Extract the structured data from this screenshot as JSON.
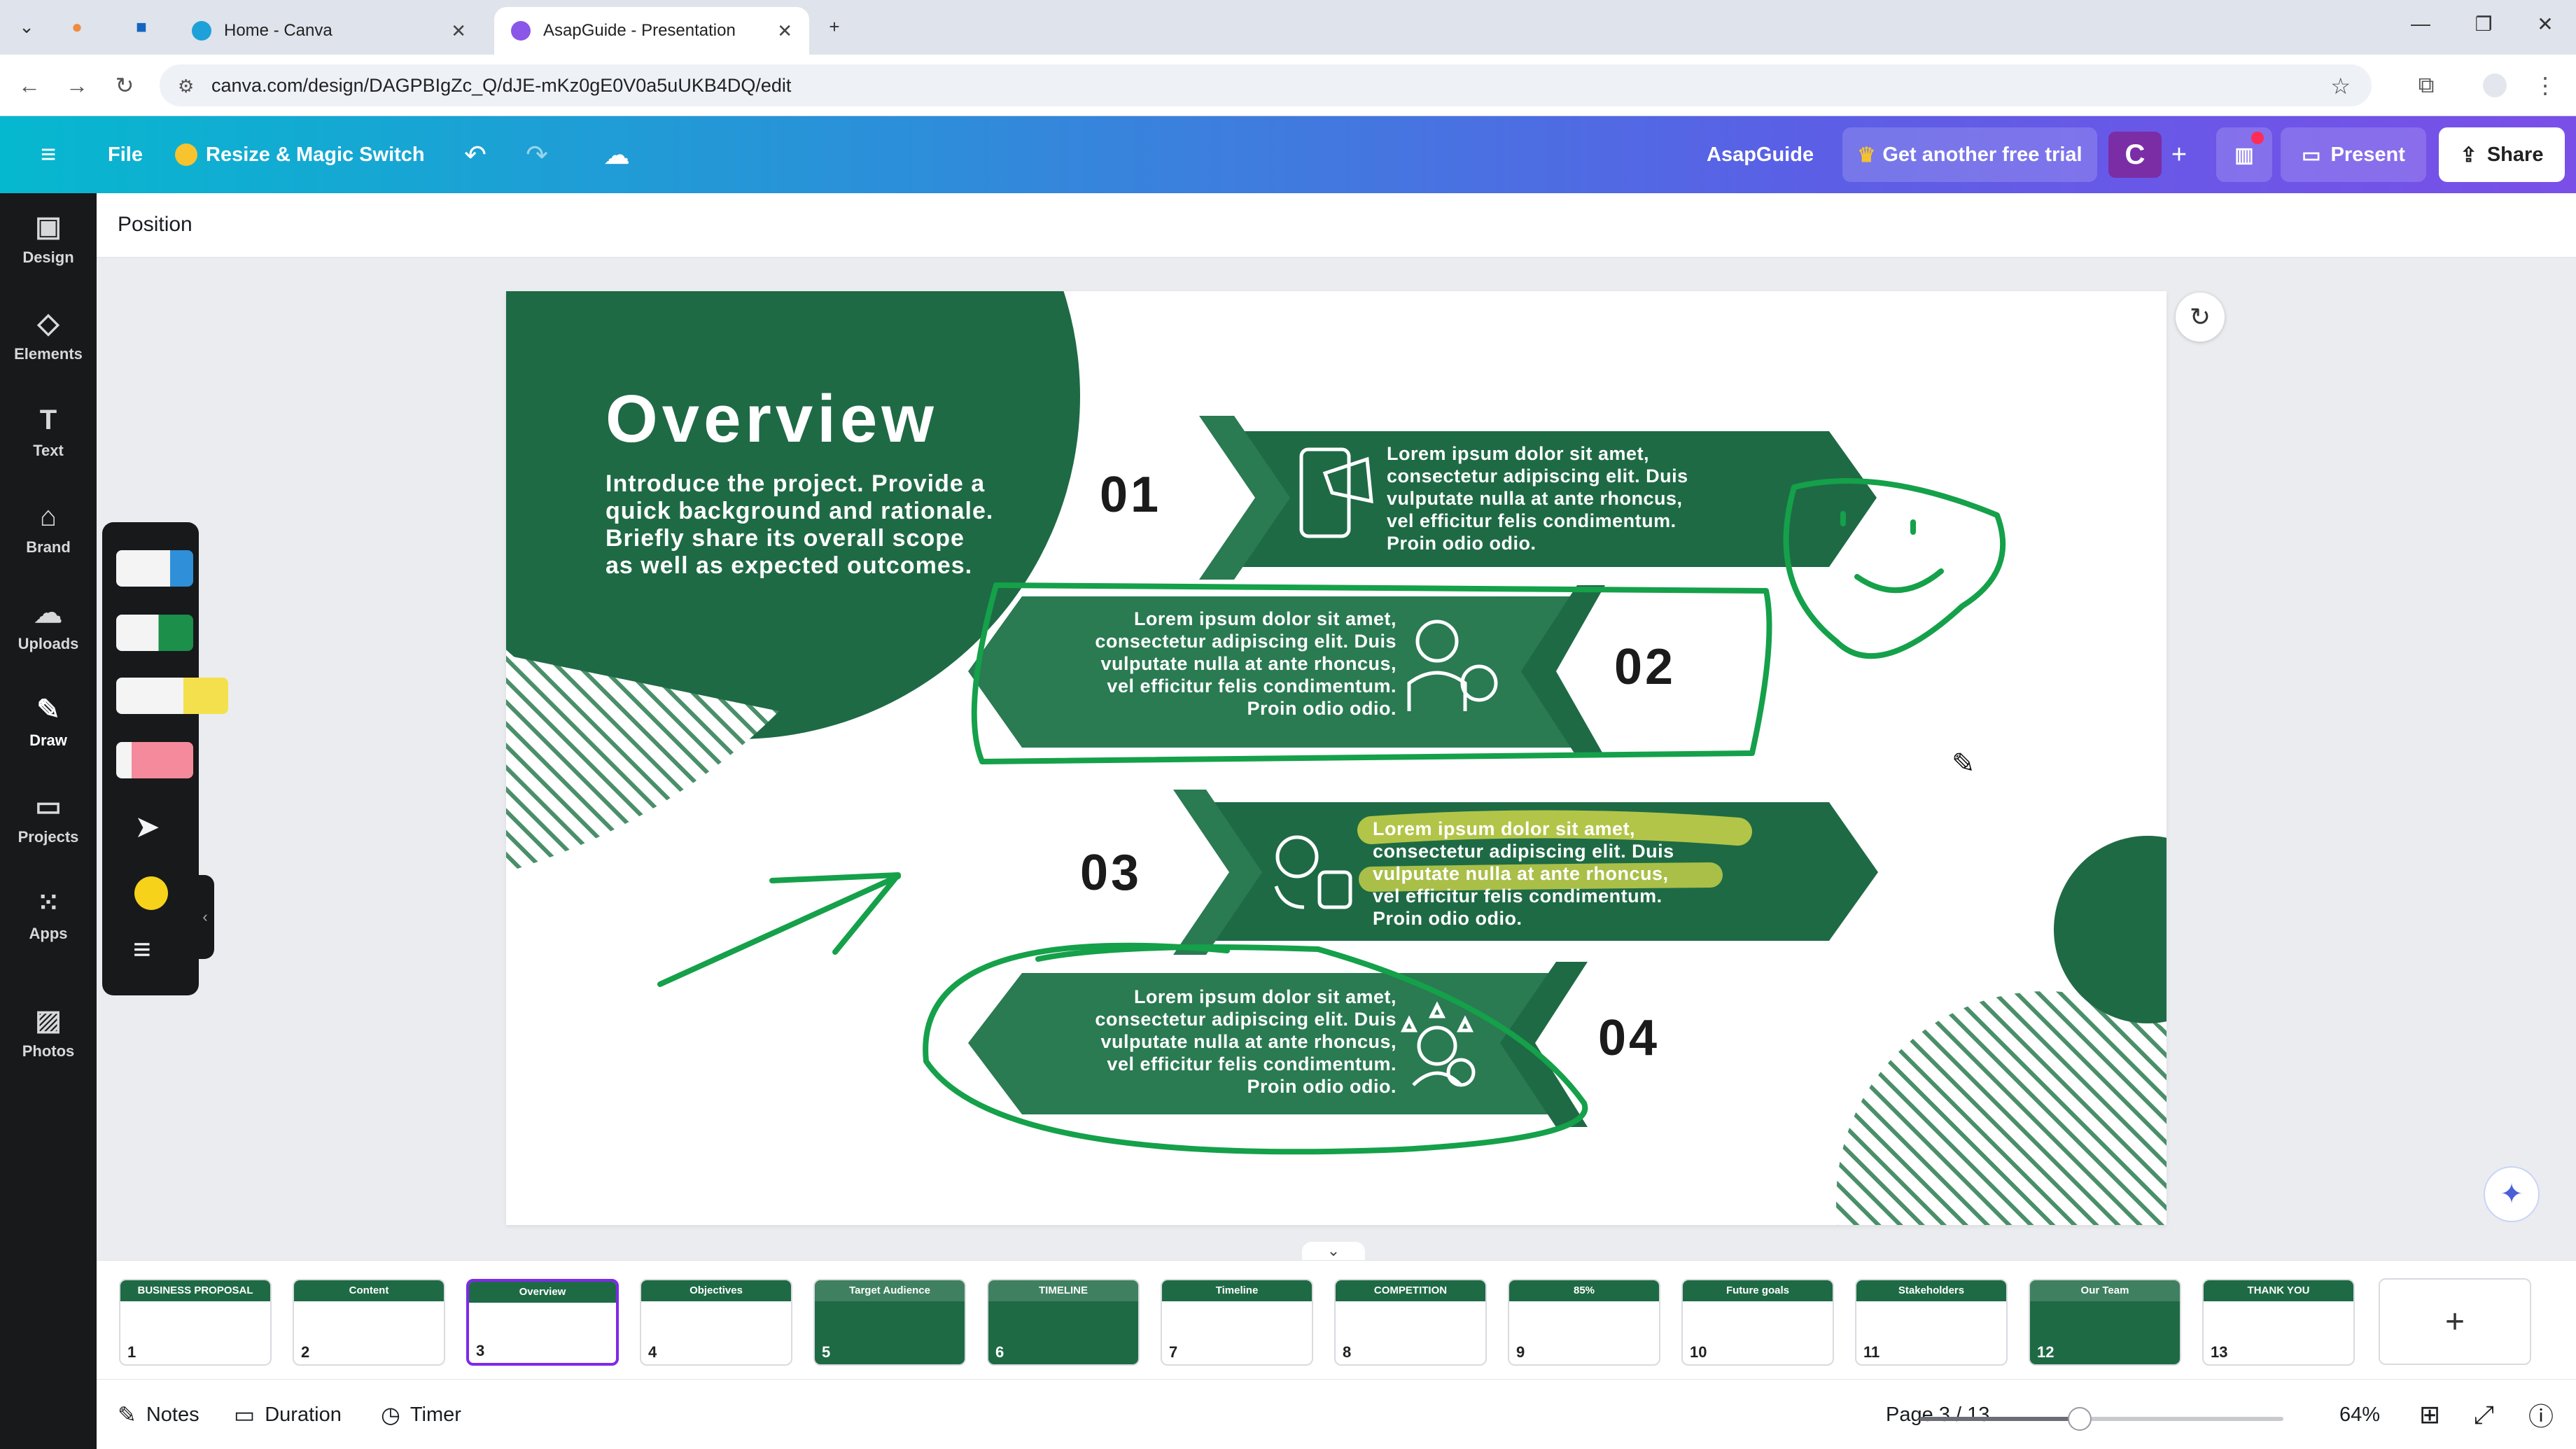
{
  "browser": {
    "tabs": [
      {
        "title": "Home - Canva",
        "active": false
      },
      {
        "title": "AsapGuide - Presentation",
        "active": true
      }
    ],
    "new_tab_icon": "plus-icon",
    "url": "canva.com/design/DAGPBIgZc_Q/dJE-mKz0gE0V0a5uUKB4DQ/edit"
  },
  "topbar": {
    "menu_icon": "hamburger-icon",
    "file_label": "File",
    "resize_label": "Resize & Magic Switch",
    "project_name": "AsapGuide",
    "trial_label": "Get another free trial",
    "avatar_initial": "C",
    "present_label": "Present",
    "share_label": "Share"
  },
  "contextbar": {
    "label": "Position"
  },
  "sidebar": {
    "items": [
      {
        "label": "Design",
        "icon": "design-icon"
      },
      {
        "label": "Elements",
        "icon": "elements-icon"
      },
      {
        "label": "Text",
        "icon": "text-icon"
      },
      {
        "label": "Brand",
        "icon": "brand-icon"
      },
      {
        "label": "Uploads",
        "icon": "uploads-icon"
      },
      {
        "label": "Draw",
        "icon": "draw-icon"
      },
      {
        "label": "Projects",
        "icon": "projects-icon"
      },
      {
        "label": "Apps",
        "icon": "apps-icon"
      },
      {
        "label": "Photos",
        "icon": "photos-icon"
      }
    ],
    "active": "Draw"
  },
  "draw_tools": {
    "pens": [
      {
        "name": "pen",
        "color": "#2f8fd8"
      },
      {
        "name": "marker",
        "color": "#1c8f4a"
      },
      {
        "name": "highlighter",
        "color": "#f4e04d"
      },
      {
        "name": "eraser",
        "color": "#f48a9b"
      }
    ],
    "selected_color": "#f6d21b"
  },
  "slide": {
    "title": "Overview",
    "intro": "Introduce the project. Provide a quick background and rationale. Briefly share its overall scope as well as expected outcomes.",
    "lorem": "Lorem ipsum dolor sit amet, consectetur adipiscing elit. Duis vulputate nulla at ante rhoncus, vel efficitur felis condimentum. Proin odio odio.",
    "items": [
      {
        "number": "01",
        "icon": "phone-megaphone-icon"
      },
      {
        "number": "02",
        "icon": "businessman-icon"
      },
      {
        "number": "03",
        "icon": "money-bag-exchange-icon"
      },
      {
        "number": "04",
        "icon": "person-stars-icon"
      }
    ],
    "colors": {
      "dark_green": "#1e6a45",
      "mid_green": "#2a7a52",
      "ink_green": "#15a04a",
      "highlight": "#e4e44a"
    }
  },
  "page_strip": {
    "pages": [
      {
        "number": "1",
        "label": "BUSINESS PROPOSAL"
      },
      {
        "number": "2",
        "label": "Content"
      },
      {
        "number": "3",
        "label": "Overview"
      },
      {
        "number": "4",
        "label": "Objectives"
      },
      {
        "number": "5",
        "label": "Target Audience"
      },
      {
        "number": "6",
        "label": "TIMELINE"
      },
      {
        "number": "7",
        "label": "Timeline"
      },
      {
        "number": "8",
        "label": "COMPETITION"
      },
      {
        "number": "9",
        "label": "85%"
      },
      {
        "number": "10",
        "label": "Future goals"
      },
      {
        "number": "11",
        "label": "Stakeholders"
      },
      {
        "number": "12",
        "label": "Our Team"
      },
      {
        "number": "13",
        "label": "THANK YOU"
      }
    ],
    "current": 3
  },
  "bottombar": {
    "notes_label": "Notes",
    "duration_label": "Duration",
    "timer_label": "Timer",
    "page_indicator": "Page 3 / 13",
    "zoom": "64%",
    "zoom_fraction": 0.44
  }
}
